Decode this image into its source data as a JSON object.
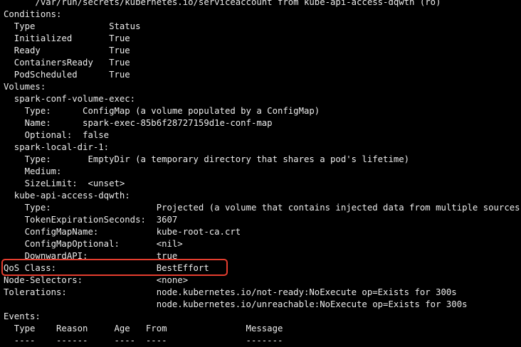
{
  "terminal": {
    "lines": [
      "      /var/run/secrets/kubernetes.io/serviceaccount from kube-api-access-dqwth (ro)",
      "Conditions:",
      "  Type              Status",
      "  Initialized       True",
      "  Ready             True",
      "  ContainersReady   True",
      "  PodScheduled      True",
      "Volumes:",
      "  spark-conf-volume-exec:",
      "    Type:      ConfigMap (a volume populated by a ConfigMap)",
      "    Name:      spark-exec-85b6f28727159d1e-conf-map",
      "    Optional:  false",
      "  spark-local-dir-1:",
      "    Type:       EmptyDir (a temporary directory that shares a pod's lifetime)",
      "    Medium:",
      "    SizeLimit:  <unset>",
      "  kube-api-access-dqwth:",
      "    Type:                    Projected (a volume that contains injected data from multiple sources)",
      "    TokenExpirationSeconds:  3607",
      "    ConfigMapName:           kube-root-ca.crt",
      "    ConfigMapOptional:       <nil>",
      "    DownwardAPI:             true",
      "QoS Class:                   BestEffort",
      "Node-Selectors:              <none>",
      "Tolerations:                 node.kubernetes.io/not-ready:NoExecute op=Exists for 300s",
      "                             node.kubernetes.io/unreachable:NoExecute op=Exists for 300s",
      "Events:",
      "  Type    Reason     Age   From               Message",
      "  ----    ------     ----  ----               -------"
    ]
  },
  "highlight": {
    "label": "QoS Class highlight",
    "color": "#e53e2f"
  },
  "colors": {
    "background": "#000000",
    "text": "#ececec"
  }
}
